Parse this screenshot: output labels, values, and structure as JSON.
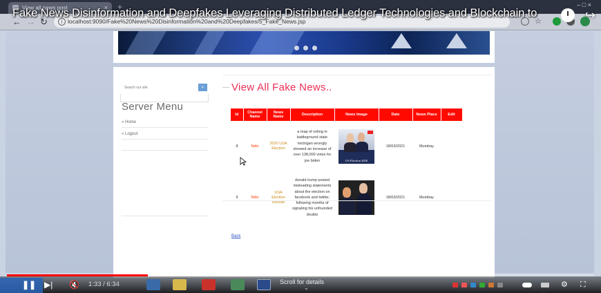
{
  "browser": {
    "tab_title": "View all news post",
    "new_tab": "+",
    "window_controls": "– □ ×",
    "url": "localhost:9090/Fake%20News%20Disinformation%20and%20Deepfakes/5_Fake_News.jsp"
  },
  "video": {
    "title": "Fake News Disinformation and Deepfakes Leveraging Distributed Ledger Technologies and Blockchain to",
    "time": "1:33 / 6:34",
    "progress_fraction": 0.24,
    "scroll_hint": "Scroll for details"
  },
  "sidebar": {
    "search_placeholder": "Search our site",
    "title": "Server Menu",
    "links": [
      "» Home",
      "» Logout"
    ]
  },
  "main": {
    "heading": "View All Fake News..",
    "columns": [
      "Id",
      "Channel Name",
      "News Name",
      "Description",
      "News Image",
      "Date",
      "News Place",
      "Edit"
    ],
    "rows": [
      {
        "id": "8",
        "channel": "Ndtv",
        "news_name": "2020 USA Election",
        "description": "a map of voting in battleground state michigan wrongly showed an increase of over 138,000 votes for joe biden",
        "image_caption": "US Election 2020",
        "date": "18/03/2021",
        "place": "Mumbay"
      },
      {
        "id": "9",
        "channel": "Ndtv",
        "news_name": "USA Election Results",
        "description": "donald trump posted misleading statements about the election on facebook and twitter, following months of signaling his unfounded doubts",
        "image_caption": "",
        "date": "18/03/2021",
        "place": "Mumbay"
      }
    ],
    "back_link": "Back"
  },
  "colors": {
    "table_header": "#ff0a00",
    "heading": "#ea2f56",
    "channel": "#ff3b00",
    "news_name": "#c98a15",
    "progress": "#ff0000"
  }
}
